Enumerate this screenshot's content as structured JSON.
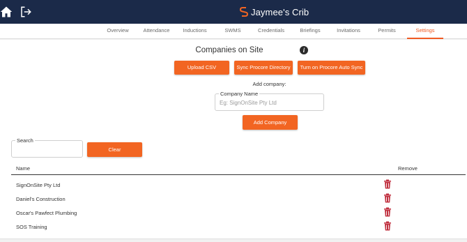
{
  "header": {
    "site_name": "Jaymee's Crib",
    "background_color": "#1b2a49",
    "home_icon": "home-icon",
    "logout_icon": "logout-icon",
    "brand_icon": "signonsite-logo-icon"
  },
  "tabs": [
    {
      "label": "Overview",
      "active": false
    },
    {
      "label": "Attendance",
      "active": false
    },
    {
      "label": "Inductions",
      "active": false
    },
    {
      "label": "SWMS",
      "active": false
    },
    {
      "label": "Credentials",
      "active": false
    },
    {
      "label": "Briefings",
      "active": false
    },
    {
      "label": "Invitations",
      "active": false
    },
    {
      "label": "Permits",
      "active": false
    },
    {
      "label": "Settings",
      "active": true
    }
  ],
  "section": {
    "title": "Companies on Site",
    "info_icon": "info-icon",
    "accent_color": "#f26522"
  },
  "actions": {
    "upload_csv": "Upload CSV",
    "sync_procore": "Sync Procore Directory",
    "auto_sync": "Turn on Procore Auto Sync"
  },
  "add_company": {
    "label": "Add company:",
    "field_label": "Company Name",
    "placeholder": "Eg: SignOnSite Pty Ltd",
    "value": "",
    "button": "Add Company"
  },
  "search": {
    "label": "Search",
    "value": "",
    "clear_button": "Clear"
  },
  "table": {
    "columns": [
      "Name",
      "Remove"
    ],
    "rows": [
      {
        "name": "SignOnSite Pty Ltd"
      },
      {
        "name": "Daniel's Construction"
      },
      {
        "name": "Oscar's Pawfect Plumbing"
      },
      {
        "name": "SOS Training"
      }
    ],
    "remove_icon": "trash-icon",
    "remove_color": "#c0303f"
  }
}
